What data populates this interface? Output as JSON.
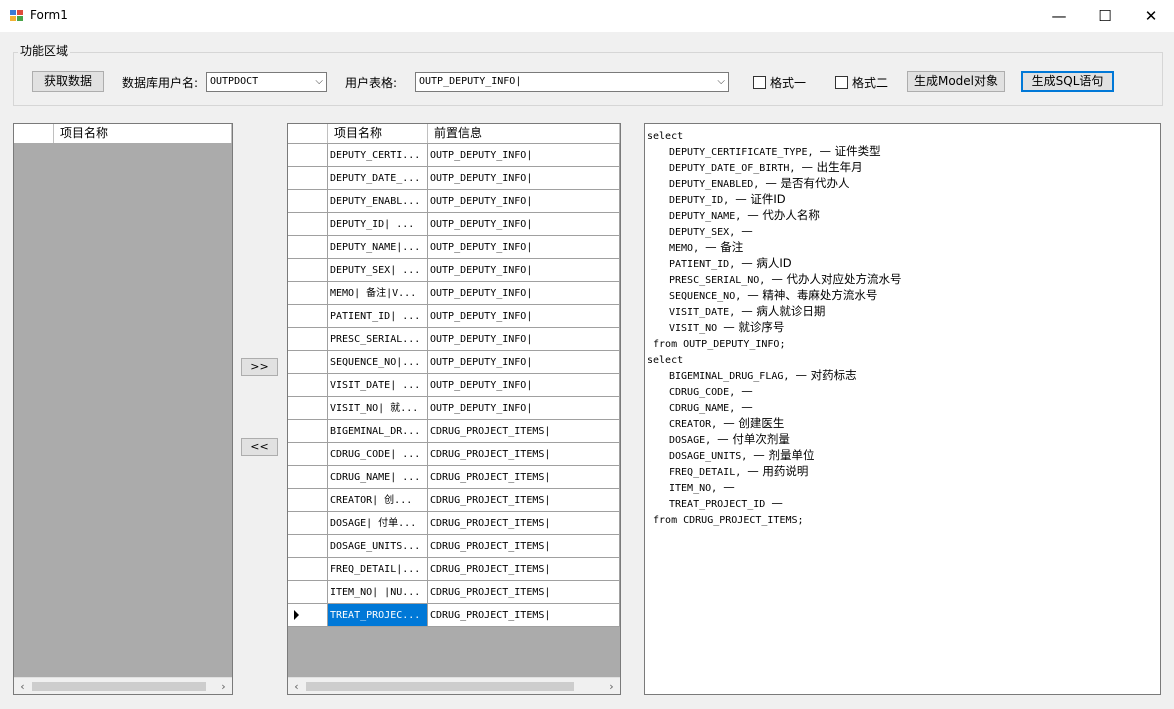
{
  "window": {
    "title": "Form1",
    "minimize": "—",
    "maximize": "☐",
    "close": "✕"
  },
  "colors": {
    "selection": "#0078d7",
    "grid_bg": "#ababab"
  },
  "group": {
    "title": "功能区域"
  },
  "toolbar": {
    "fetch_label": "获取数据",
    "db_user_label": "数据库用户名:",
    "db_user_value": "OUTPDOCT",
    "table_label": "用户表格:",
    "table_value": "OUTP_DEPUTY_INFO|",
    "format1_label": "格式一",
    "format2_label": "格式二",
    "model_label": "生成Model对象",
    "sql_label": "生成SQL语句"
  },
  "left_grid": {
    "header": "项目名称"
  },
  "move_right_label": ">>",
  "move_left_label": "<<",
  "right_grid": {
    "headers": [
      "项目名称",
      "前置信息"
    ],
    "rows": [
      {
        "name": "DEPUTY_CERTI...",
        "info": "OUTP_DEPUTY_INFO|"
      },
      {
        "name": "DEPUTY_DATE_...",
        "info": "OUTP_DEPUTY_INFO|"
      },
      {
        "name": "DEPUTY_ENABL...",
        "info": "OUTP_DEPUTY_INFO|"
      },
      {
        "name": "DEPUTY_ID| ...",
        "info": "OUTP_DEPUTY_INFO|"
      },
      {
        "name": "DEPUTY_NAME|...",
        "info": "OUTP_DEPUTY_INFO|"
      },
      {
        "name": "DEPUTY_SEX| ...",
        "info": "OUTP_DEPUTY_INFO|"
      },
      {
        "name": "MEMO| 备注|V...",
        "info": "OUTP_DEPUTY_INFO|"
      },
      {
        "name": "PATIENT_ID| ...",
        "info": "OUTP_DEPUTY_INFO|"
      },
      {
        "name": "PRESC_SERIAL...",
        "info": "OUTP_DEPUTY_INFO|"
      },
      {
        "name": "SEQUENCE_NO|...",
        "info": "OUTP_DEPUTY_INFO|"
      },
      {
        "name": "VISIT_DATE| ...",
        "info": "OUTP_DEPUTY_INFO|"
      },
      {
        "name": "VISIT_NO| 就...",
        "info": "OUTP_DEPUTY_INFO|"
      },
      {
        "name": "BIGEMINAL_DR...",
        "info": "CDRUG_PROJECT_ITEMS|"
      },
      {
        "name": "CDRUG_CODE| ...",
        "info": "CDRUG_PROJECT_ITEMS|"
      },
      {
        "name": "CDRUG_NAME| ...",
        "info": "CDRUG_PROJECT_ITEMS|"
      },
      {
        "name": "CREATOR| 创...",
        "info": "CDRUG_PROJECT_ITEMS|"
      },
      {
        "name": "DOSAGE| 付单...",
        "info": "CDRUG_PROJECT_ITEMS|"
      },
      {
        "name": "DOSAGE_UNITS...",
        "info": "CDRUG_PROJECT_ITEMS|"
      },
      {
        "name": "FREQ_DETAIL|...",
        "info": "CDRUG_PROJECT_ITEMS|"
      },
      {
        "name": "ITEM_NO| |NU...",
        "info": "CDRUG_PROJECT_ITEMS|"
      },
      {
        "name": "TREAT_PROJEC...",
        "info": "CDRUG_PROJECT_ITEMS|"
      }
    ],
    "selected_row": 20
  },
  "sql_text": [
    {
      "code": "select",
      "comment": "",
      "indent": 0
    },
    {
      "code": "DEPUTY_CERTIFICATE_TYPE, ",
      "comment": "— 证件类型",
      "indent": 1
    },
    {
      "code": "DEPUTY_DATE_OF_BIRTH, ",
      "comment": "— 出生年月",
      "indent": 1
    },
    {
      "code": "DEPUTY_ENABLED, ",
      "comment": "— 是否有代办人",
      "indent": 1
    },
    {
      "code": "DEPUTY_ID, ",
      "comment": "— 证件ID",
      "indent": 1
    },
    {
      "code": "DEPUTY_NAME, ",
      "comment": "— 代办人名称",
      "indent": 1
    },
    {
      "code": "DEPUTY_SEX, ",
      "comment": "—",
      "indent": 1
    },
    {
      "code": "MEMO, ",
      "comment": "— 备注",
      "indent": 1
    },
    {
      "code": "PATIENT_ID, ",
      "comment": "— 病人ID",
      "indent": 1
    },
    {
      "code": "PRESC_SERIAL_NO, ",
      "comment": "— 代办人对应处方流水号",
      "indent": 1
    },
    {
      "code": "SEQUENCE_NO, ",
      "comment": "— 精神、毒麻处方流水号",
      "indent": 1
    },
    {
      "code": "VISIT_DATE, ",
      "comment": "— 病人就诊日期",
      "indent": 1
    },
    {
      "code": "VISIT_NO ",
      "comment": "— 就诊序号",
      "indent": 1
    },
    {
      "code": " from OUTP_DEPUTY_INFO;",
      "comment": "",
      "indent": 0
    },
    {
      "code": "select",
      "comment": "",
      "indent": 0
    },
    {
      "code": "BIGEMINAL_DRUG_FLAG, ",
      "comment": "— 对药标志",
      "indent": 1
    },
    {
      "code": "CDRUG_CODE, ",
      "comment": "—",
      "indent": 1
    },
    {
      "code": "CDRUG_NAME, ",
      "comment": "—",
      "indent": 1
    },
    {
      "code": "CREATOR, ",
      "comment": "— 创建医生",
      "indent": 1
    },
    {
      "code": "DOSAGE, ",
      "comment": "— 付单次剂量",
      "indent": 1
    },
    {
      "code": "DOSAGE_UNITS, ",
      "comment": "— 剂量单位",
      "indent": 1
    },
    {
      "code": "FREQ_DETAIL, ",
      "comment": "— 用药说明",
      "indent": 1
    },
    {
      "code": "ITEM_NO, ",
      "comment": "—",
      "indent": 1
    },
    {
      "code": "TREAT_PROJECT_ID ",
      "comment": "—",
      "indent": 1
    },
    {
      "code": " from CDRUG_PROJECT_ITEMS;",
      "comment": "",
      "indent": 0
    }
  ]
}
